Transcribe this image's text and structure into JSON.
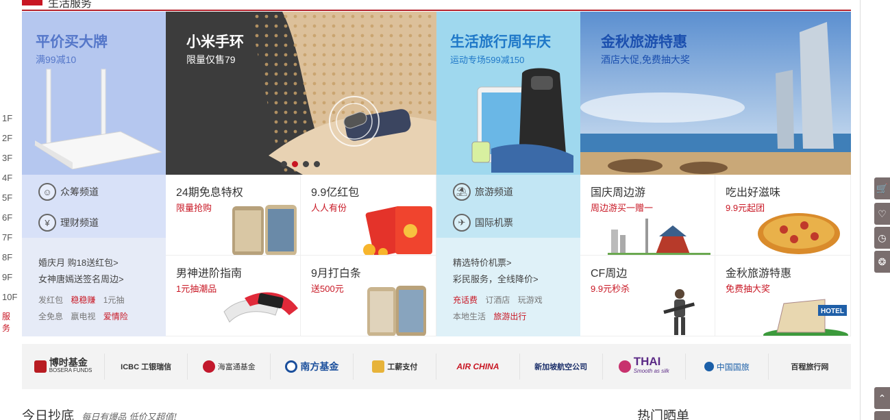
{
  "header": {
    "section_title": "生活服务"
  },
  "floor_nav": [
    "1F",
    "2F",
    "3F",
    "4F",
    "5F",
    "6F",
    "7F",
    "8F",
    "9F",
    "10F",
    "服务"
  ],
  "col1": {
    "banner_title": "平价买大牌",
    "banner_sub": "满99减10",
    "channels": [
      "众筹频道",
      "理财频道"
    ],
    "links": [
      "婚庆月 购18送红包>",
      "女神唐嫣送签名周边>"
    ],
    "tags_row1": [
      "发红包",
      "稳稳赚",
      "1元抽"
    ],
    "tags_row2": [
      "全免息",
      "嬴电视",
      "爱情险"
    ]
  },
  "col2": {
    "banner_title": "小米手环",
    "banner_sub": "限量仅售79",
    "tiles": [
      {
        "title": "24期免息特权",
        "sub": "限量抢购"
      },
      {
        "title": "9.9亿红包",
        "sub": "人人有份"
      },
      {
        "title": "男神进阶指南",
        "sub": "1元抽潮品"
      },
      {
        "title": "9月打白条",
        "sub": "送500元"
      }
    ]
  },
  "col3": {
    "banner_title": "生活旅行周年庆",
    "banner_sub": "运动专场599减150",
    "channels": [
      "旅游频道",
      "国际机票"
    ],
    "links": [
      "精选特价机票>",
      "彩民服务，全线降价>"
    ],
    "tags_row1": [
      "充话费",
      "订酒店",
      "玩游戏"
    ],
    "tags_row2": [
      "本地生活",
      "旅游出行"
    ]
  },
  "col4": {
    "banner_title": "金秋旅游特惠",
    "banner_sub": "酒店大促,免费抽大奖",
    "tiles": [
      {
        "title": "国庆周边游",
        "sub": "周边游买一赠一"
      },
      {
        "title": "吃出好滋味",
        "sub": "9.9元起团"
      },
      {
        "title": "CF周边",
        "sub": "9.9元秒杀"
      },
      {
        "title": "金秋旅游特惠",
        "sub": "免费抽大奖"
      }
    ]
  },
  "logos": [
    "博时基金",
    "ICBC 工银瑞信",
    "海富通基金",
    "南方基金",
    "工薪支付",
    "AIR CHINA",
    "新加坡航空公司",
    "THAI",
    "中国国旅",
    "百程旅行网"
  ],
  "logo_subs": {
    "bosera": "BOSERA FUNDS",
    "thai": "Smooth as silk"
  },
  "bottom": {
    "left_title": "今日抄底",
    "left_sub": "每日有爆品 低价又超值!",
    "right_title": "热门晒单"
  },
  "colors": {
    "accent": "#c81623"
  }
}
